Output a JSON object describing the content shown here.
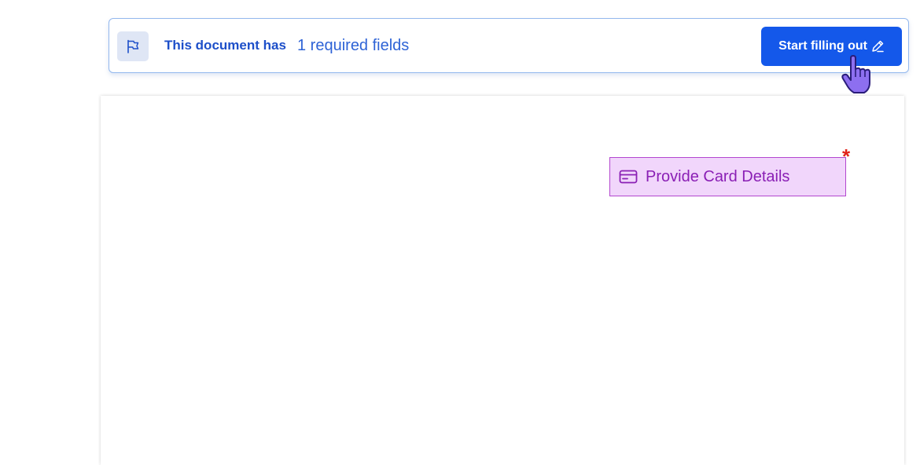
{
  "banner": {
    "message": "This document has",
    "count_text": "1 required fields",
    "start_button_label": "Start filling out"
  },
  "field": {
    "label": "Provide Card Details",
    "required_mark": "*"
  },
  "icons": {
    "banner": "flag-icon",
    "button": "pen-icon",
    "field": "credit-card-icon",
    "cursor": "hand-pointer-icon"
  },
  "colors": {
    "accent": "#1458ea",
    "banner_border": "#93b8ee",
    "field_bg": "#f1d6fb",
    "field_border": "#b347cf",
    "field_text": "#8a1fb5",
    "required": "#e0231a"
  }
}
